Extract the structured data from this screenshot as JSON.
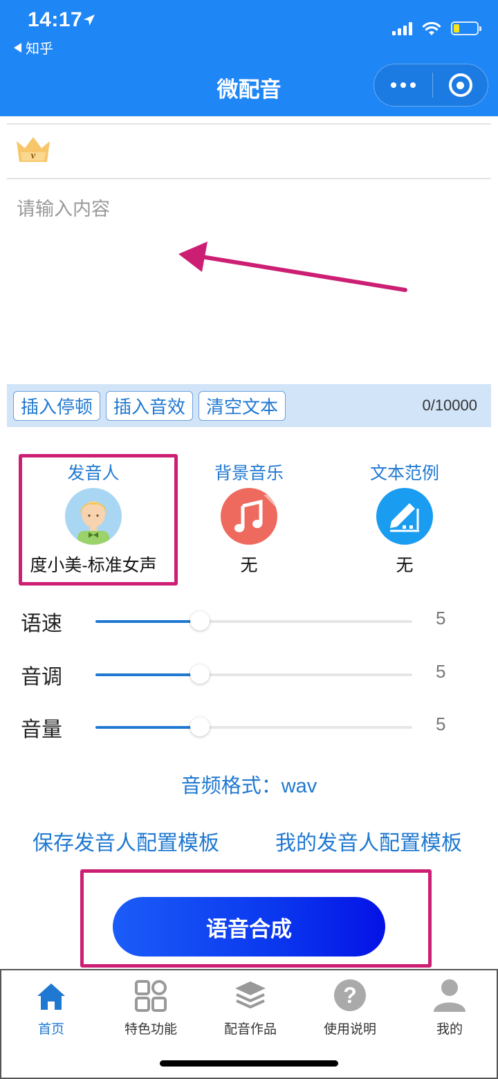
{
  "status_bar": {
    "time": "14:17",
    "back_app": "知乎"
  },
  "header": {
    "title": "微配音"
  },
  "editor": {
    "placeholder": "请输入内容",
    "char_count": "0/10000"
  },
  "toolbar": {
    "insert_pause": "插入停顿",
    "insert_sound": "插入音效",
    "clear_text": "清空文本"
  },
  "options": {
    "speaker": {
      "label": "发音人",
      "value": "度小美-标准女声"
    },
    "bgm": {
      "label": "背景音乐",
      "value": "无"
    },
    "sample": {
      "label": "文本范例",
      "value": "无"
    }
  },
  "sliders": [
    {
      "label": "语速",
      "value": "5",
      "fraction": 0.33
    },
    {
      "label": "音调",
      "value": "5",
      "fraction": 0.33
    },
    {
      "label": "音量",
      "value": "5",
      "fraction": 0.33
    }
  ],
  "audio_format": "音频格式：wav",
  "templates": {
    "save": "保存发音人配置模板",
    "mine": "我的发音人配置模板"
  },
  "synthesize": "语音合成",
  "tabs": [
    {
      "label": "首页",
      "icon": "home-icon",
      "active": true
    },
    {
      "label": "特色功能",
      "icon": "grid-icon",
      "active": false
    },
    {
      "label": "配音作品",
      "icon": "layers-icon",
      "active": false
    },
    {
      "label": "使用说明",
      "icon": "help-icon",
      "active": false
    },
    {
      "label": "我的",
      "icon": "user-icon",
      "active": false
    }
  ],
  "colors": {
    "brand": "#1f86f6",
    "link": "#1f78d1",
    "highlight": "#cc1f74",
    "synth_button": "#0a37ee"
  }
}
